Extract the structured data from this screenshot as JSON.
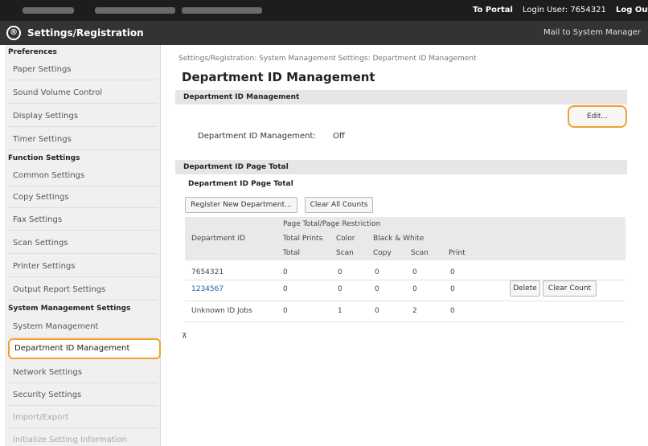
{
  "topbar": {
    "portal_link": "To Portal",
    "login_user": "Login User: 7654321",
    "logout": "Log Out"
  },
  "header": {
    "logo_glyph": "®",
    "title": "Settings/Registration",
    "mail_link": "Mail to System Manager"
  },
  "sidebar": {
    "groups": [
      {
        "heading": "Preferences",
        "items": [
          "Paper Settings",
          "Sound Volume Control",
          "Display Settings",
          "Timer Settings"
        ]
      },
      {
        "heading": "Function Settings",
        "items": [
          "Common Settings",
          "Copy Settings",
          "Fax Settings",
          "Scan Settings",
          "Printer Settings",
          "Output Report Settings"
        ]
      },
      {
        "heading": "System Management Settings",
        "items": [
          "System Management",
          "Department ID Management",
          "Network Settings",
          "Security Settings",
          "Import/Export",
          "Initialize Setting Information"
        ]
      }
    ],
    "active_item": "Department ID Management"
  },
  "main": {
    "breadcrumb": "Settings/Registration: System Management Settings: Department ID Management",
    "page_title": "Department ID Management",
    "section1_title": "Department ID Management",
    "edit_button": "Edit...",
    "dept_mgmt_label": "Department ID Management:",
    "dept_mgmt_value": "Off",
    "section2_title": "Department ID Page Total",
    "subsection_title": "Department ID Page Total",
    "register_button": "Register New Department...",
    "clear_all_button": "Clear All Counts",
    "table": {
      "col_department": "Department ID",
      "group_header": "Page Total/Page Restriction",
      "total_prints": "Total Prints",
      "color": "Color",
      "bw": "Black & White",
      "sub_total": "Total",
      "sub_color_scan": "Scan",
      "sub_copy": "Copy",
      "sub_bw_scan": "Scan",
      "sub_print": "Print",
      "rows": [
        {
          "id": "7654321",
          "total": "0",
          "color_scan": "0",
          "copy": "0",
          "bw_scan": "0",
          "print": "0",
          "link": false
        },
        {
          "id": "1234567",
          "total": "0",
          "color_scan": "0",
          "copy": "0",
          "bw_scan": "0",
          "print": "0",
          "link": true
        },
        {
          "id": "Unknown ID Jobs",
          "total": "0",
          "color_scan": "1",
          "copy": "0",
          "bw_scan": "2",
          "print": "0",
          "link": false
        }
      ]
    },
    "delete_button": "Delete",
    "clear_count_button": "Clear Count",
    "scroll_top_glyph": "⊼"
  },
  "colors": {
    "topbar_bg": "#1d1d1d",
    "header_bg": "#333333",
    "highlight": "#f0a030",
    "link": "#1a5fb0"
  }
}
